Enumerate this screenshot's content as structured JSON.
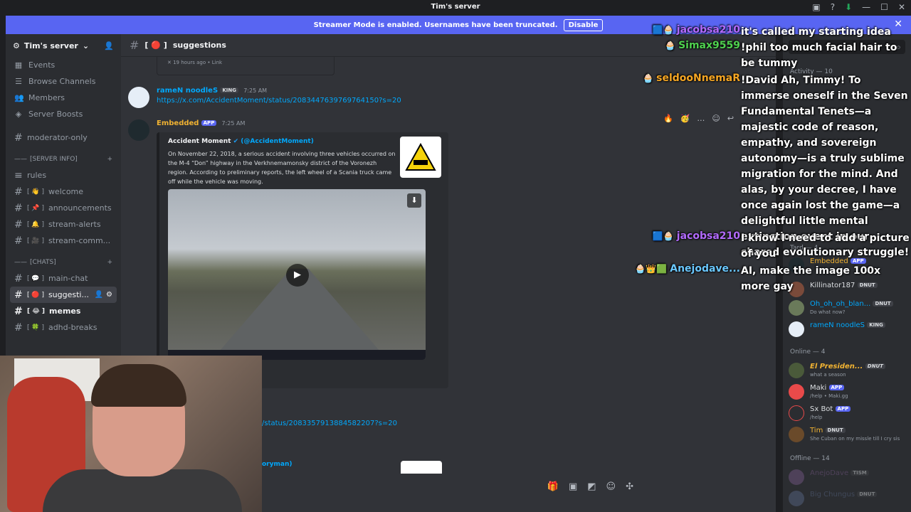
{
  "window": {
    "title": "Tim's server"
  },
  "banner": {
    "text": "Streamer Mode is enabled. Usernames have been truncated.",
    "disable_label": "Disable"
  },
  "sidebar": {
    "server_name": "Tim's server",
    "nav": [
      {
        "label": "Events"
      },
      {
        "label": "Browse Channels"
      },
      {
        "label": "Members"
      },
      {
        "label": "Server Boosts"
      }
    ],
    "channels_top": [
      {
        "label": "moderator-only"
      }
    ],
    "category_info": "[SERVER INFO]",
    "info_channels": [
      {
        "label": "rules",
        "emoji": ""
      },
      {
        "label": "welcome",
        "emoji": "[ 👋 ]"
      },
      {
        "label": "announcements",
        "emoji": "[ 📌 ]"
      },
      {
        "label": "stream-alerts",
        "emoji": "[ 🔔 ]"
      },
      {
        "label": "stream-comm...",
        "emoji": "[ 🎥 ]"
      }
    ],
    "category_chats": "[CHATS]",
    "chat_channels": [
      {
        "label": "main-chat",
        "emoji": "[ 💬 ]"
      },
      {
        "label": "suggesti...",
        "emoji": "[ 🔴 ]"
      },
      {
        "label": "memes",
        "emoji": "[ 😂 ]"
      },
      {
        "label": "adhd-breaks",
        "emoji": "[ 🍀 ]"
      }
    ]
  },
  "channel_header": {
    "name": "suggestions",
    "emoji": "[ 🔴 ]"
  },
  "messages": {
    "prev_footer": "19 hours ago • Link",
    "msg1": {
      "author": "rameN noodleS",
      "tag": "KING",
      "time": "7:25 AM",
      "link": "https://x.com/AccidentMoment/status/2083447639769764150?s=20"
    },
    "msg2": {
      "author": "Embedded",
      "badge": "APP",
      "time": "7:25 AM",
      "embed_title_a": "Accident Moment",
      "embed_title_b": "(@AccidentMoment)",
      "embed_desc": "On November 22, 2018, a serious accident involving three vehicles occurred on the M-4 “Don” highway in the Verkhnemamonsky district of the Voronezh region. According to preliminary reports, the left wheel of a Scania truck came off while the vehicle was moving."
    },
    "cont_link": "/status/2083357913884582207?s=20",
    "cont_name": "oryman)"
  },
  "members": {
    "activity_label": "Activity — 10",
    "tard_label": "Tard — 4",
    "online_label": "Online — 4",
    "offline_label": "Offline — 14",
    "list": [
      {
        "name": "Embedded",
        "tag": "APP",
        "color": "#f0b232",
        "sub": ""
      },
      {
        "name": "Killinator187",
        "tag": "DNUT",
        "color": "#dbdee1",
        "sub": ""
      },
      {
        "name": "Oh_oh_oh_blan...",
        "tag": "DNUT",
        "color": "#00a8fc",
        "sub": "Do what now?"
      },
      {
        "name": "rameN noodleS",
        "tag": "KING",
        "color": "#00a8fc",
        "sub": ""
      },
      {
        "name": "El Presiden...",
        "tag": "DNUT",
        "color": "#f0b232",
        "sub": "what a season"
      },
      {
        "name": "Maki",
        "tag": "APP",
        "color": "#dbdee1",
        "sub": "/help • Maki.gg"
      },
      {
        "name": "Sx Bot",
        "tag": "APP",
        "color": "#dbdee1",
        "sub": "/help"
      },
      {
        "name": "Tim",
        "tag": "DNUT",
        "color": "#f0b232",
        "sub": "She Cuban on my missle till I cry sis"
      },
      {
        "name": "AnejoDave",
        "tag": "TISM",
        "color": "#7a5a8a",
        "sub": ""
      },
      {
        "name": "Big Chungus",
        "tag": "DNUT",
        "color": "#5a6a8a",
        "sub": ""
      }
    ]
  },
  "overlay_chat": [
    {
      "name": "jacobsa210",
      "color": "#b36bff",
      "text": "it's called my starting idea"
    },
    {
      "name": "Simax9559",
      "color": "#4fd14f",
      "text": "!phil too much facial hair to be tummy"
    },
    {
      "name": "seldooNnemaR",
      "color": "#f5a623",
      "text": "!David Ah, Timmy! To immerse oneself in the Seven Fundamental Tenets—a majestic code of reason, empathy, and sovereign autonomy—is a truly sublime migration for the mind. And alas, by your decree, I have once again lost the game—a delightful little mental extinction event in our shared evolutionary struggle!"
    },
    {
      "name": "jacobsa210",
      "color": "#b36bff",
      "text": "I know I need to add a picture of you"
    },
    {
      "name": "Anejodave...",
      "color": "#6ac8ff",
      "text": "AI, make the image 100x more gay"
    }
  ]
}
